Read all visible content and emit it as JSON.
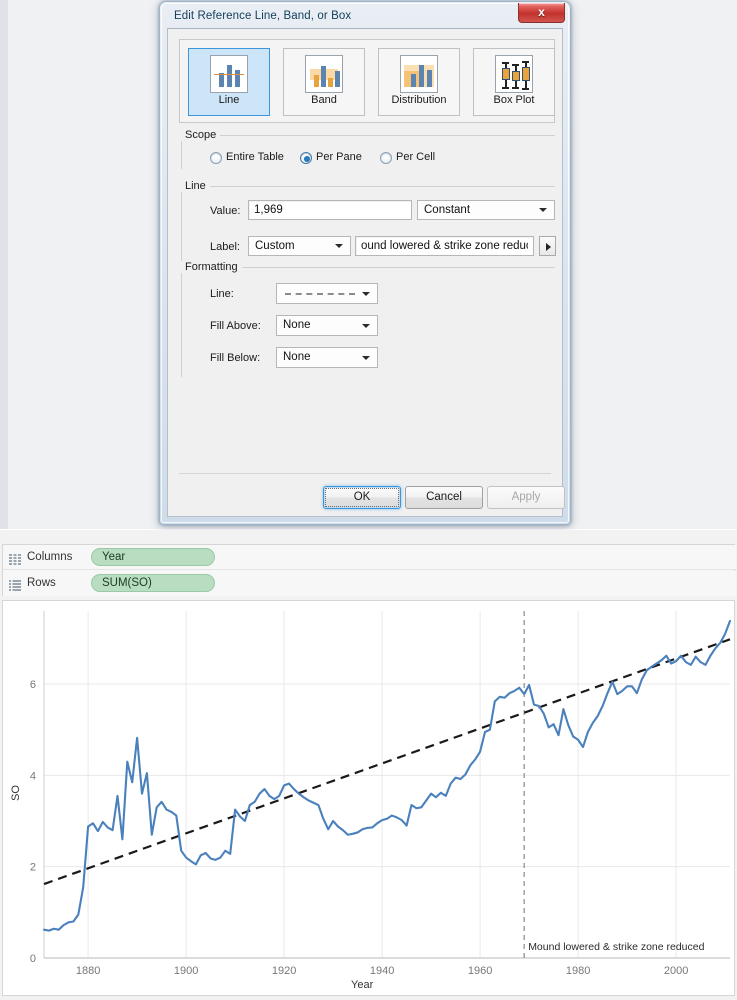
{
  "dialog": {
    "title": "Edit Reference Line, Band, or Box",
    "close_icon": "close-icon",
    "close_label": "x",
    "types": [
      {
        "label": "Line",
        "icon": "reference-line-icon",
        "selected": true
      },
      {
        "label": "Band",
        "icon": "reference-band-icon",
        "selected": false
      },
      {
        "label": "Distribution",
        "icon": "reference-distribution-icon",
        "selected": false
      },
      {
        "label": "Box Plot",
        "icon": "reference-boxplot-icon",
        "selected": false
      }
    ],
    "scope": {
      "legend": "Scope",
      "options": [
        {
          "label": "Entire Table",
          "selected": false
        },
        {
          "label": "Per Pane",
          "selected": true
        },
        {
          "label": "Per Cell",
          "selected": false
        }
      ]
    },
    "line": {
      "legend": "Line",
      "value_label": "Value:",
      "value": "1,969",
      "aggregation": "Constant",
      "label_label": "Label:",
      "label_mode": "Custom",
      "label_text": "ound lowered & strike zone reduced",
      "label_text_full": "Mound lowered & strike zone reduced",
      "expand_icon": "play-arrow-icon"
    },
    "formatting": {
      "legend": "Formatting",
      "line_label": "Line:",
      "line_style": "dashed",
      "fill_above_label": "Fill Above:",
      "fill_above": "None",
      "fill_below_label": "Fill Below:",
      "fill_below": "None"
    },
    "buttons": {
      "ok": "OK",
      "cancel": "Cancel",
      "apply": "Apply",
      "ok_focused": true,
      "apply_disabled": true
    }
  },
  "worksheet": {
    "shelves": [
      {
        "name": "Columns",
        "icon": "columns-shelf-icon",
        "pill": "Year"
      },
      {
        "name": "Rows",
        "icon": "rows-shelf-icon",
        "pill": "SUM(SO)"
      }
    ]
  },
  "colors": {
    "series_blue": "#4a81bd",
    "trend_black": "#1a1a1a",
    "reference_gray": "#9a9a9a",
    "grid": "#e8e8e8",
    "pill_green": "#b8ddc0",
    "accent_blue": "#3c96dc"
  },
  "chart_data": {
    "type": "line",
    "title": "",
    "xlabel": "Year",
    "ylabel": "SO",
    "xlim": [
      1871,
      2011
    ],
    "ylim": [
      0,
      7.6
    ],
    "xticks": [
      1880,
      1900,
      1920,
      1940,
      1960,
      1980,
      2000
    ],
    "yticks": [
      0,
      2,
      4,
      6
    ],
    "grid": true,
    "legend": "none",
    "annotations": [
      {
        "type": "reference-line",
        "orientation": "vertical",
        "value": 1969,
        "label": "Mound lowered & strike zone reduced",
        "style": "dashed",
        "color": "#9a9a9a"
      },
      {
        "type": "trend-line",
        "style": "dashed",
        "color": "#1a1a1a",
        "x": [
          1871,
          2011
        ],
        "y": [
          1.62,
          6.98
        ]
      }
    ],
    "series": [
      {
        "name": "SUM(SO)",
        "color": "#4a81bd",
        "x": [
          1871,
          1872,
          1873,
          1874,
          1875,
          1876,
          1877,
          1878,
          1879,
          1880,
          1881,
          1882,
          1883,
          1884,
          1885,
          1886,
          1887,
          1888,
          1889,
          1890,
          1891,
          1892,
          1893,
          1894,
          1895,
          1896,
          1897,
          1898,
          1899,
          1900,
          1901,
          1902,
          1903,
          1904,
          1905,
          1906,
          1907,
          1908,
          1909,
          1910,
          1911,
          1912,
          1913,
          1914,
          1915,
          1916,
          1917,
          1918,
          1919,
          1920,
          1921,
          1922,
          1923,
          1924,
          1925,
          1926,
          1927,
          1928,
          1929,
          1930,
          1931,
          1932,
          1933,
          1934,
          1935,
          1936,
          1937,
          1938,
          1939,
          1940,
          1941,
          1942,
          1943,
          1944,
          1945,
          1946,
          1947,
          1948,
          1949,
          1950,
          1951,
          1952,
          1953,
          1954,
          1955,
          1956,
          1957,
          1958,
          1959,
          1960,
          1961,
          1962,
          1963,
          1964,
          1965,
          1966,
          1967,
          1968,
          1969,
          1970,
          1971,
          1972,
          1973,
          1974,
          1975,
          1976,
          1977,
          1978,
          1979,
          1980,
          1981,
          1982,
          1983,
          1984,
          1985,
          1986,
          1987,
          1988,
          1989,
          1990,
          1991,
          1992,
          1993,
          1994,
          1995,
          1996,
          1997,
          1998,
          1999,
          2000,
          2001,
          2002,
          2003,
          2004,
          2005,
          2006,
          2007,
          2008,
          2009,
          2010,
          2011
        ],
        "y": [
          0.62,
          0.6,
          0.64,
          0.62,
          0.72,
          0.78,
          0.8,
          0.95,
          1.55,
          2.88,
          2.95,
          2.78,
          2.98,
          2.86,
          2.8,
          3.55,
          2.6,
          4.3,
          3.85,
          4.82,
          3.6,
          4.05,
          2.7,
          3.3,
          3.42,
          3.25,
          3.2,
          3.12,
          2.35,
          2.2,
          2.12,
          2.05,
          2.25,
          2.3,
          2.18,
          2.15,
          2.2,
          2.35,
          2.28,
          3.25,
          3.1,
          3.0,
          3.35,
          3.42,
          3.6,
          3.7,
          3.55,
          3.48,
          3.55,
          3.78,
          3.82,
          3.7,
          3.6,
          3.52,
          3.45,
          3.4,
          3.35,
          3.05,
          2.82,
          3.0,
          2.88,
          2.8,
          2.7,
          2.72,
          2.75,
          2.82,
          2.85,
          2.86,
          2.95,
          3.02,
          3.05,
          3.12,
          3.08,
          3.02,
          2.9,
          3.35,
          3.28,
          3.3,
          3.45,
          3.6,
          3.52,
          3.62,
          3.55,
          3.82,
          3.95,
          3.92,
          4.02,
          4.22,
          4.35,
          4.52,
          4.95,
          5.0,
          5.62,
          5.72,
          5.7,
          5.8,
          5.85,
          5.92,
          5.78,
          5.98,
          5.55,
          5.52,
          5.35,
          5.05,
          5.12,
          4.88,
          5.45,
          5.1,
          4.85,
          4.78,
          4.62,
          4.95,
          5.15,
          5.3,
          5.52,
          5.8,
          6.05,
          5.78,
          5.85,
          5.95,
          5.95,
          5.8,
          6.1,
          6.3,
          6.38,
          6.45,
          6.52,
          6.62,
          6.45,
          6.5,
          6.62,
          6.48,
          6.42,
          6.6,
          6.48,
          6.42,
          6.62,
          6.78,
          6.9,
          7.1,
          7.38
        ]
      }
    ]
  }
}
